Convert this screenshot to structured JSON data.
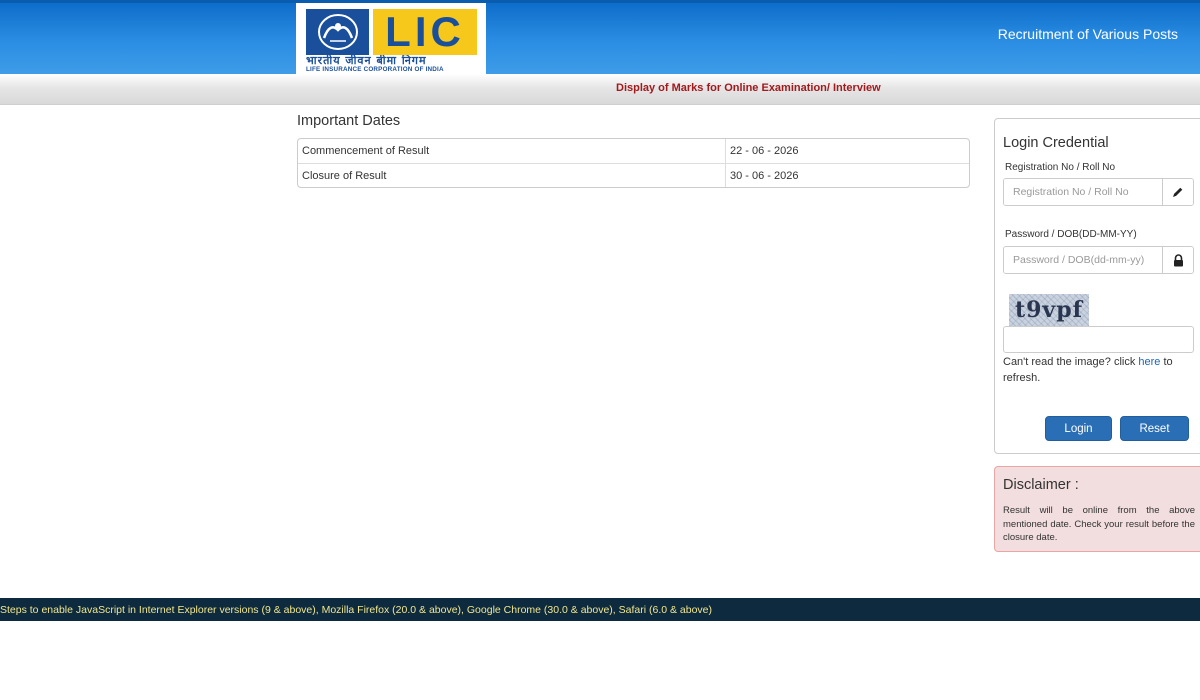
{
  "header": {
    "logo": {
      "letters": "LIC",
      "hindi": "भारतीय जीवन बीमा निगम",
      "english": "LIFE INSURANCE CORPORATION OF INDIA"
    },
    "title": "Recruitment of Various Posts",
    "subtitle": "Display of Marks for Online Examination/ Interview"
  },
  "important_dates": {
    "heading": "Important Dates",
    "rows": [
      {
        "label": "Commencement of Result",
        "value": "22 - 06 - 2026"
      },
      {
        "label": "Closure of Result",
        "value": "30 - 06 - 2026"
      }
    ]
  },
  "login": {
    "title": "Login Credential",
    "registration_label": "Registration No / Roll No",
    "registration_placeholder": "Registration No / Roll No",
    "password_label": "Password / DOB(DD-MM-YY)",
    "password_placeholder": "Password / DOB(dd-mm-yy)",
    "captcha_text": "t9vpf",
    "refresh_prefix": "Can't read the image? click ",
    "refresh_link": "here",
    "refresh_suffix": " to refresh.",
    "login_label": "Login",
    "reset_label": "Reset",
    "icons": {
      "registration": "pencil-icon",
      "password": "lock-icon"
    }
  },
  "disclaimer": {
    "title": "Disclaimer :",
    "text": "Result will be online from the above mentioned date. Check your result before the closure date."
  },
  "footer": {
    "text": "Steps to enable JavaScript in Internet Explorer versions (9 & above), Mozilla Firefox (20.0 & above), Google Chrome (30.0 & above), Safari (6.0 & above)"
  },
  "colors": {
    "header_blue": "#2b8ee3",
    "subtitle_red": "#a3191c",
    "button_blue": "#2a6fb6",
    "disclaimer_bg": "#f2dede",
    "footer_bg": "#0e2a3f",
    "footer_text": "#f2e78a",
    "logo_yellow": "#f6c81c",
    "logo_blue": "#1a4f9c"
  }
}
